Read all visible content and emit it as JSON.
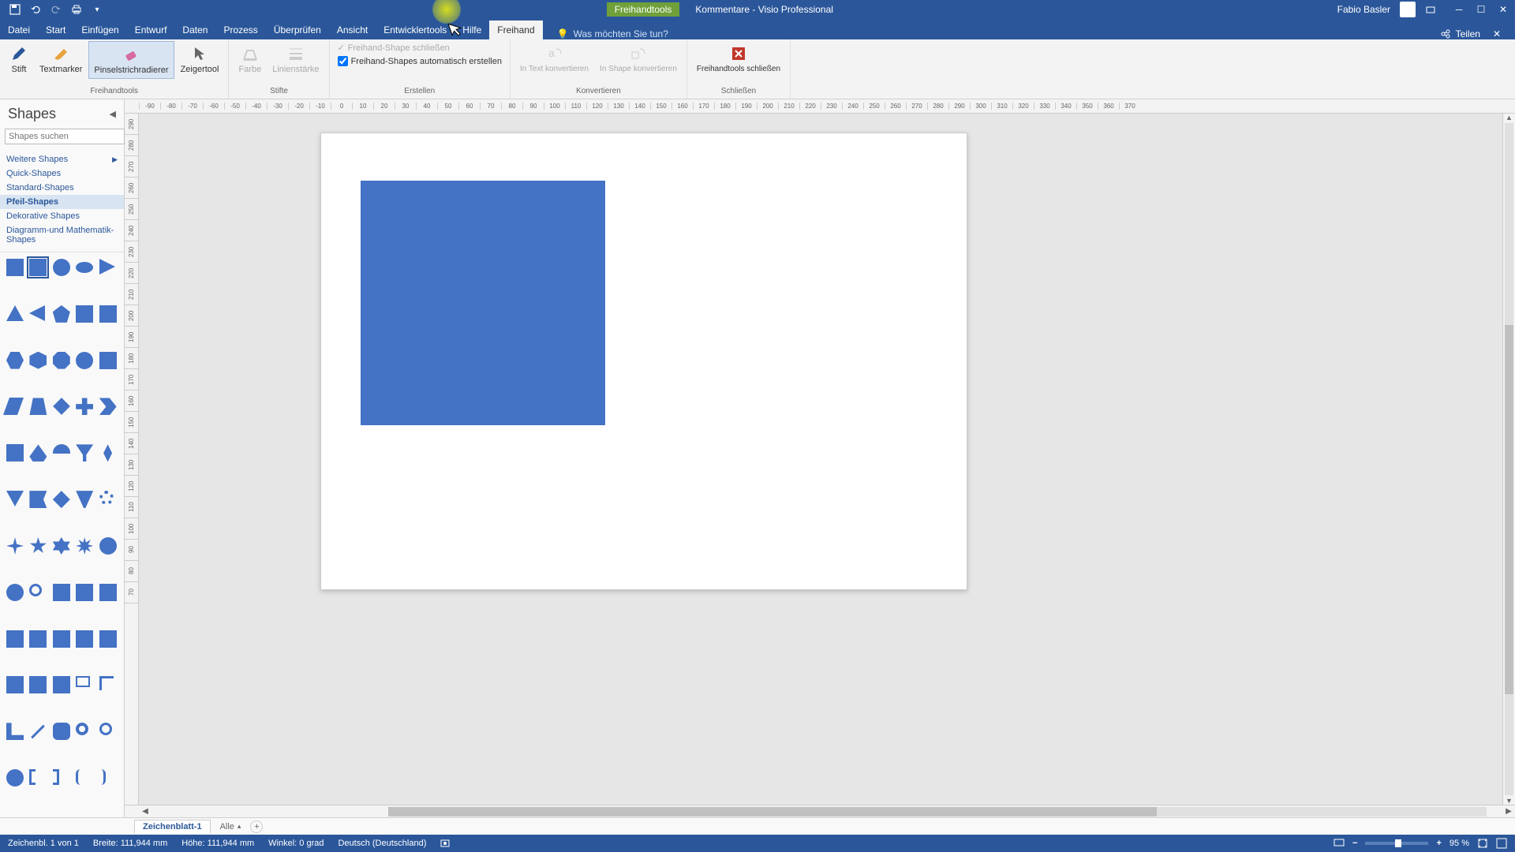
{
  "title_bar": {
    "context_tool": "Freihandtools",
    "doc_title": "Kommentare - Visio Professional",
    "user": "Fabio Basler"
  },
  "menu": {
    "items": [
      "Datei",
      "Start",
      "Einfügen",
      "Entwurf",
      "Daten",
      "Prozess",
      "Überprüfen",
      "Ansicht",
      "Entwicklertools",
      "Hilfe",
      "Freihand"
    ],
    "tell_me": "Was möchten Sie tun?",
    "share": "Teilen"
  },
  "ribbon": {
    "group1": {
      "label": "Freihandtools",
      "stift": "Stift",
      "textmarker": "Textmarker",
      "pinsel": "Pinselstrichradierer",
      "zeiger": "Zeigertool"
    },
    "group2": {
      "label": "Stifte",
      "farbe": "Farbe",
      "linien": "Linienstärke"
    },
    "group3": {
      "label": "Erstellen",
      "close_shape": "Freihand-Shape schließen",
      "auto_create": "Freihand-Shapes automatisch erstellen"
    },
    "group4": {
      "label": "Konvertieren",
      "in_text": "In Text konvertieren",
      "in_shape": "In Shape konvertieren"
    },
    "group5": {
      "label": "Schließen",
      "close_tools": "Freihandtools schließen"
    }
  },
  "shapes_panel": {
    "title": "Shapes",
    "search_placeholder": "Shapes suchen",
    "categories": {
      "more": "Weitere Shapes",
      "quick": "Quick-Shapes",
      "standard": "Standard-Shapes",
      "pfeil": "Pfeil-Shapes",
      "dekorativ": "Dekorative Shapes",
      "diagramm": "Diagramm-und Mathematik-Shapes"
    }
  },
  "ruler_h": [
    "-90",
    "-80",
    "-70",
    "-60",
    "-50",
    "-40",
    "-30",
    "-20",
    "-10",
    "0",
    "10",
    "20",
    "30",
    "40",
    "50",
    "60",
    "70",
    "80",
    "90",
    "100",
    "110",
    "120",
    "130",
    "140",
    "150",
    "160",
    "170",
    "180",
    "190",
    "200",
    "210",
    "220",
    "230",
    "240",
    "250",
    "260",
    "270",
    "280",
    "290",
    "300",
    "310",
    "320",
    "330",
    "340",
    "350",
    "360",
    "370"
  ],
  "ruler_v": [
    "290",
    "280",
    "270",
    "260",
    "250",
    "240",
    "230",
    "220",
    "210",
    "200",
    "190",
    "180",
    "170",
    "160",
    "150",
    "140",
    "130",
    "120",
    "110",
    "100",
    "90",
    "80",
    "70"
  ],
  "page_tabs": {
    "tab1": "Zeichenblatt-1",
    "all": "Alle"
  },
  "status": {
    "page": "Zeichenbl. 1 von 1",
    "breite": "Breite: 111,944 mm",
    "hoehe": "Höhe: 111,944 mm",
    "winkel": "Winkel: 0 grad",
    "lang": "Deutsch (Deutschland)",
    "zoom": "95 %"
  }
}
